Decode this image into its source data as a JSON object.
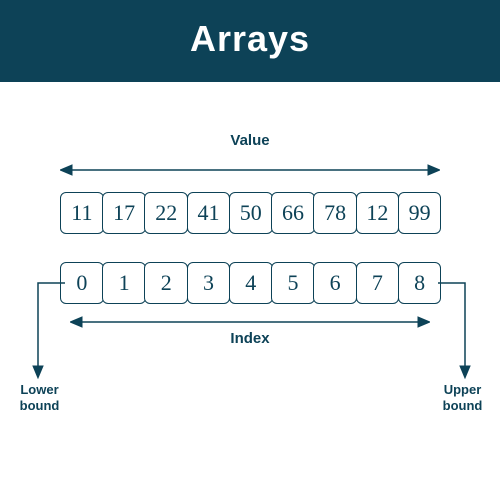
{
  "title": "Arrays",
  "labels": {
    "value": "Value",
    "index": "Index",
    "lower_bound_line1": "Lower",
    "lower_bound_line2": "bound",
    "upper_bound_line1": "Upper",
    "upper_bound_line2": "bound"
  },
  "array": {
    "values": [
      "11",
      "17",
      "22",
      "41",
      "50",
      "66",
      "78",
      "12",
      "99"
    ],
    "indices": [
      "0",
      "1",
      "2",
      "3",
      "4",
      "5",
      "6",
      "7",
      "8"
    ]
  },
  "colors": {
    "brand": "#0d4257"
  }
}
